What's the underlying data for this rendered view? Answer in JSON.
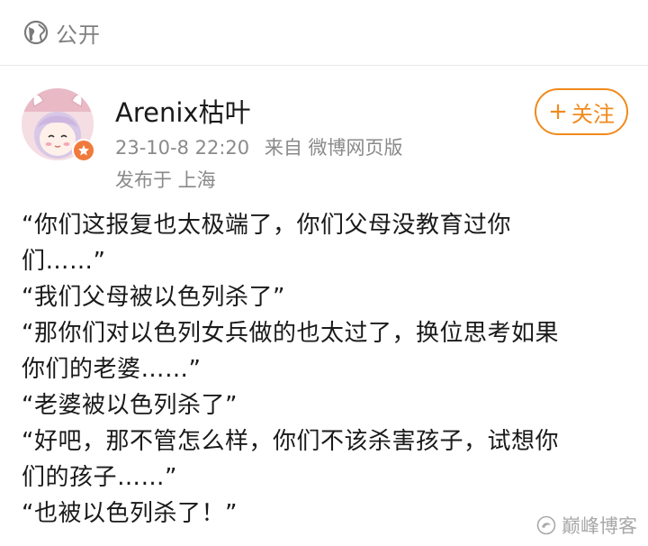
{
  "visibility": {
    "icon": "globe-icon",
    "label": "公开"
  },
  "post": {
    "author": {
      "name": "Arenix枯叶",
      "avatar_icon": "avatar-anime-girl",
      "badge_icon": "verified-badge-icon",
      "badge_color": "#f07a3c"
    },
    "date": "23-10-8 22:20",
    "source": "来自 微博网页版",
    "location": "发布于 上海",
    "follow_button": {
      "label": "关注",
      "icon": "plus-icon",
      "color": "#f08a1c"
    },
    "lines": [
      "“你们这报复也太极端了，你们父母没教育过你",
      "们……”",
      "“我们父母被以色列杀了”",
      "“那你们对以色列女兵做的也太过了，换位思考如果",
      "你们的老婆……”",
      "“老婆被以色列杀了”",
      "“好吧，那不管怎么样，你们不该杀害孩子，试想你",
      "们的孩子……”",
      "“也被以色列杀了！”"
    ]
  },
  "watermark": {
    "text": "巅峰博客",
    "icon": "watermark-logo-icon"
  }
}
